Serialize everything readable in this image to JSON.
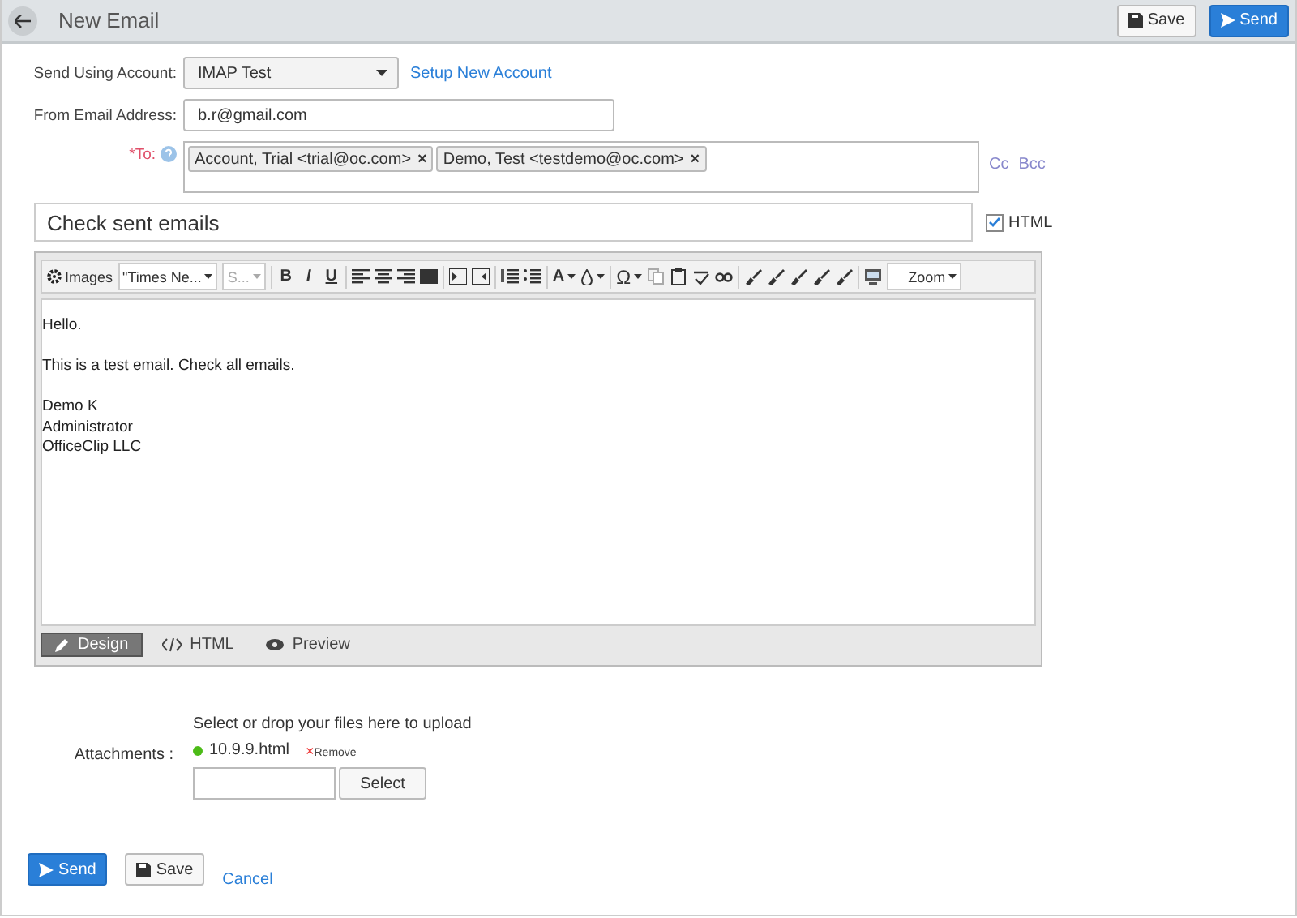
{
  "header": {
    "title": "New Email",
    "buttons": [
      {
        "kind": "save",
        "label": "Save"
      },
      {
        "kind": "send",
        "label": "Send"
      }
    ]
  },
  "account": {
    "label": "Send Using Account:",
    "value": "IMAP Test",
    "link": "Setup New Account"
  },
  "from": {
    "label": "From Email Address:",
    "value": "b.r@gmail.com"
  },
  "to": {
    "label": "*To:",
    "recipients": [
      "Account, Trial <trial@oc.com>",
      "Demo, Test <testdemo@oc.com>"
    ],
    "remove": "×",
    "cc": "Cc",
    "bcc": "Bcc"
  },
  "subject": {
    "value": "Check sent emails"
  },
  "html_option": {
    "label": "HTML",
    "checked": true
  },
  "toolbar": {
    "images": "Images",
    "font": "\"Times Ne...",
    "size": "S...",
    "bold": "B",
    "italic": "I",
    "underline": "U",
    "font_color": "A",
    "symbol": "Ω",
    "zoom": "Zoom"
  },
  "body": {
    "paragraphs": [
      [
        "Hello."
      ],
      [
        "This is a test email. Check all emails."
      ],
      [
        "Demo K",
        "Administrator",
        "OfficeClip LLC"
      ]
    ]
  },
  "editor_tabs": [
    {
      "kind": "design",
      "label": "Design",
      "selected": true
    },
    {
      "kind": "html",
      "label": "HTML",
      "selected": false
    },
    {
      "kind": "preview",
      "label": "Preview",
      "selected": false
    }
  ],
  "attachments": {
    "label": "Attachments :",
    "hint": "Select or drop your files here to upload",
    "files": [
      {
        "name": "10.9.9.html",
        "color": "#4cbb17",
        "remove": "Remove",
        "remove_mark": "×"
      }
    ],
    "select": "Select"
  },
  "footer": {
    "buttons": [
      {
        "kind": "send",
        "label": "Send"
      },
      {
        "kind": "save",
        "label": "Save"
      }
    ],
    "cancel": "Cancel"
  }
}
